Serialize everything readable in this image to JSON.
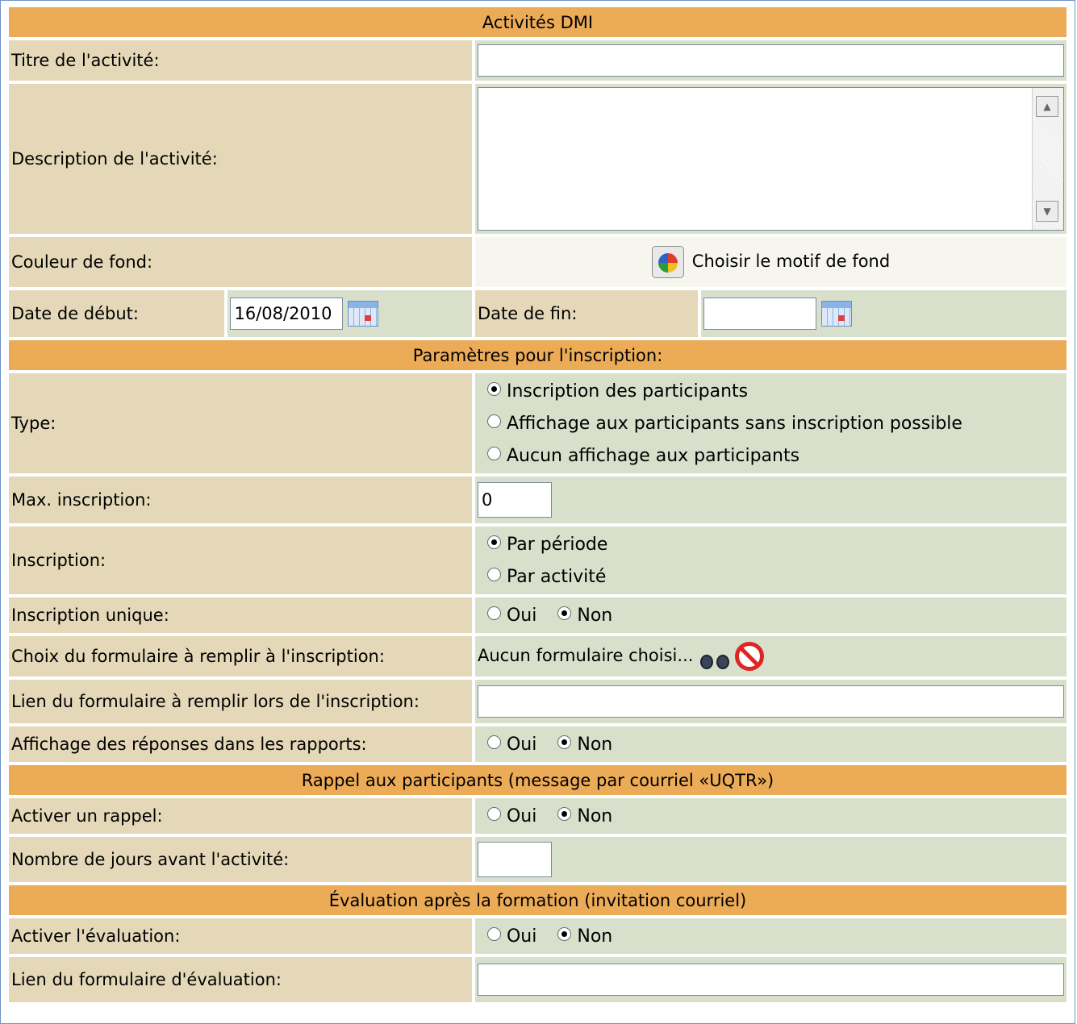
{
  "section_headers": {
    "activity": "Activités DMI",
    "registration": "Paramètres pour l'inscription:",
    "reminder": "Rappel aux participants (message par courriel «UQTR»)",
    "evaluation": "Évaluation après la formation (invitation courriel)"
  },
  "activity": {
    "title_label": "Titre de l'activité:",
    "title_value": "",
    "description_label": "Description de l'activité:",
    "description_value": "",
    "background_label": "Couleur de fond:",
    "background_button": "Choisir le motif de fond",
    "start_label": "Date de début:",
    "start_value": "16/08/2010",
    "end_label": "Date de fin:",
    "end_value": ""
  },
  "registration": {
    "type_label": "Type:",
    "type_options": [
      "Inscription des participants",
      "Affichage aux participants sans inscription possible",
      "Aucun affichage aux participants"
    ],
    "type_selected": 0,
    "max_label": "Max. inscription:",
    "max_value": "0",
    "mode_label": "Inscription:",
    "mode_options": [
      "Par période",
      "Par activité"
    ],
    "mode_selected": 0,
    "unique_label": "Inscription unique:",
    "form_choice_label": "Choix du formulaire à remplir à l'inscription:",
    "form_choice_value": "Aucun formulaire choisi...",
    "form_link_label": "Lien du formulaire à remplir lors de l'inscription:",
    "form_link_value": "",
    "show_answers_label": "Affichage des réponses dans les rapports:"
  },
  "reminder": {
    "activate_label": "Activer un rappel:",
    "days_label": "Nombre de jours avant l'activité:",
    "days_value": ""
  },
  "evaluation": {
    "activate_label": "Activer l'évaluation:",
    "link_label": "Lien du formulaire d'évaluation:",
    "link_value": ""
  },
  "yesno": {
    "yes": "Oui",
    "no": "Non"
  },
  "icons": [
    "calendar-icon",
    "palette-icon",
    "binoculars-icon",
    "no-entry-icon"
  ],
  "colors": {
    "header": "#ebab57",
    "label": "#e4d8b8",
    "value": "#d8e0cb",
    "border": "#6f93c6"
  }
}
